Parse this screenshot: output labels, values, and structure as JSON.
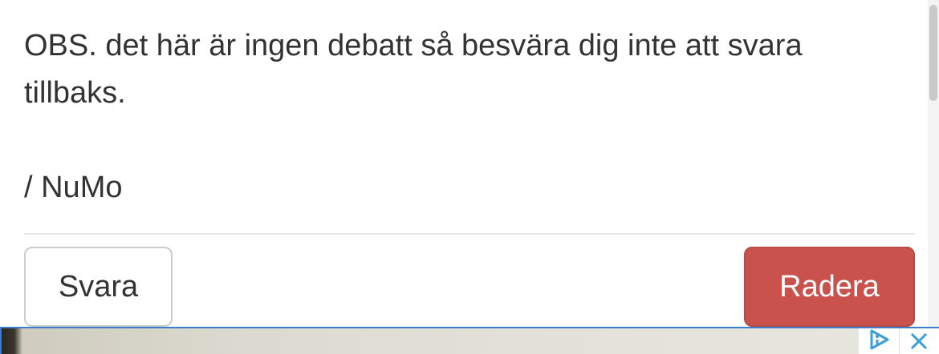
{
  "post": {
    "body_line_1": "OBS. det här är ingen debatt så besvära dig inte att svara",
    "body_line_2": "tillbaks.",
    "signature": "/ NuMo"
  },
  "actions": {
    "reply_label": "Svara",
    "delete_label": "Radera"
  },
  "colors": {
    "text": "#333333",
    "delete_button": "#c9524d",
    "ad_border": "#3d7cc9"
  },
  "ad": {
    "adchoices_icon": "adchoices-icon",
    "close_icon": "close-icon"
  }
}
